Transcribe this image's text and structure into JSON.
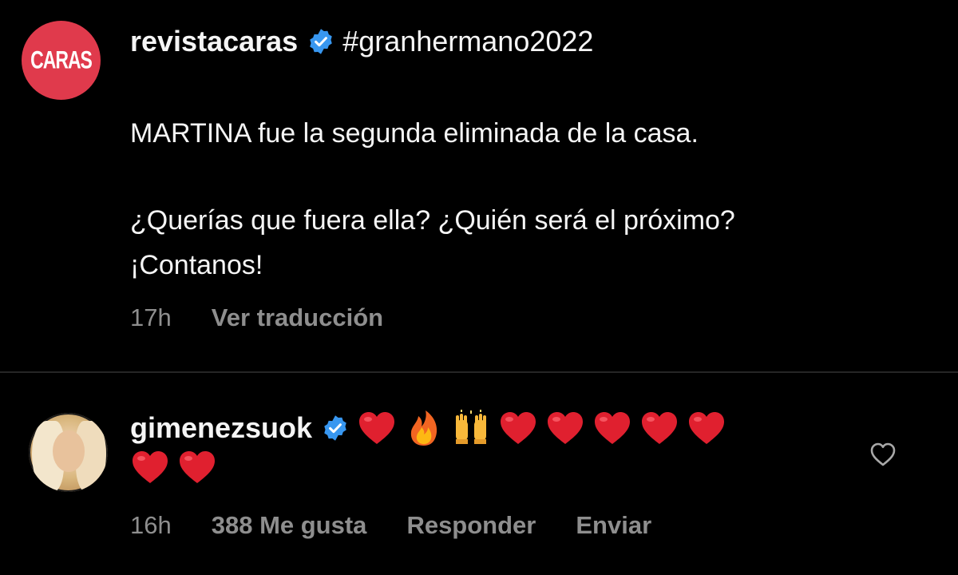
{
  "post": {
    "avatar_logo_text": "CARAS",
    "username": "revistacaras",
    "verified_icon": "verified-badge-icon",
    "hashtag": "#granhermano2022",
    "caption_lines": [
      "MARTINA fue la segunda eliminada de la casa.",
      "¿Querías que fuera ella? ¿Quién será el próximo?",
      "¡Contanos!"
    ],
    "time": "17h",
    "translate_label": "Ver traducción"
  },
  "comment": {
    "username": "gimenezsuok",
    "verified_icon": "verified-badge-icon",
    "emojis_line1": [
      "red-heart",
      "fire",
      "raised-hands",
      "red-heart",
      "red-heart",
      "red-heart",
      "red-heart",
      "red-heart"
    ],
    "emojis_line2": [
      "red-heart",
      "red-heart"
    ],
    "time": "16h",
    "likes": "388 Me gusta",
    "reply_label": "Responder",
    "send_label": "Enviar",
    "like_icon": "heart-outline-icon"
  },
  "colors": {
    "background": "#000000",
    "text": "#f5f5f5",
    "meta": "#8e8e8e",
    "verified": "#3897f0",
    "caras_red": "#e03a4c",
    "divider": "#262626"
  }
}
